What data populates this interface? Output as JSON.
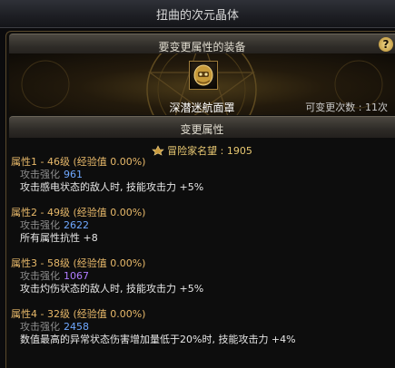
{
  "window": {
    "title": "扭曲的次元晶体"
  },
  "equip_section": {
    "title": "要变更属性的装备",
    "help_symbol": "?",
    "item_name": "深潜迷航面罩",
    "change_count_label": "可变更次数",
    "change_count_value": "11次"
  },
  "change_section": {
    "title": "变更属性"
  },
  "fame": {
    "label": "冒险家名望",
    "value": "1905"
  },
  "attributes": [
    {
      "head": "属性1 - 46级 (经验值 0.00%)",
      "sub_label": "攻击强化",
      "sub_value": "961",
      "sub_color": "#6fa8ff",
      "desc": "攻击感电状态的敌人时, 技能攻击力 +5%"
    },
    {
      "head": "属性2 - 49级 (经验值 0.00%)",
      "sub_label": "攻击强化",
      "sub_value": "2622",
      "sub_color": "#6fa8ff",
      "desc": "所有属性抗性 +8"
    },
    {
      "head": "属性3 - 58级 (经验值 0.00%)",
      "sub_label": "攻击强化",
      "sub_value": "1067",
      "sub_color": "#b07cff",
      "desc": "攻击灼伤状态的敌人时, 技能攻击力 +5%"
    },
    {
      "head": "属性4 - 32级 (经验值 0.00%)",
      "sub_label": "攻击强化",
      "sub_value": "2458",
      "sub_color": "#6fa8ff",
      "desc": "数值最高的异常状态伤害增加量低于20%时, 技能攻击力 +4%"
    }
  ],
  "icons": {
    "item": "golden-mask-icon",
    "fame": "fame-emblem-icon",
    "help": "help-icon"
  }
}
